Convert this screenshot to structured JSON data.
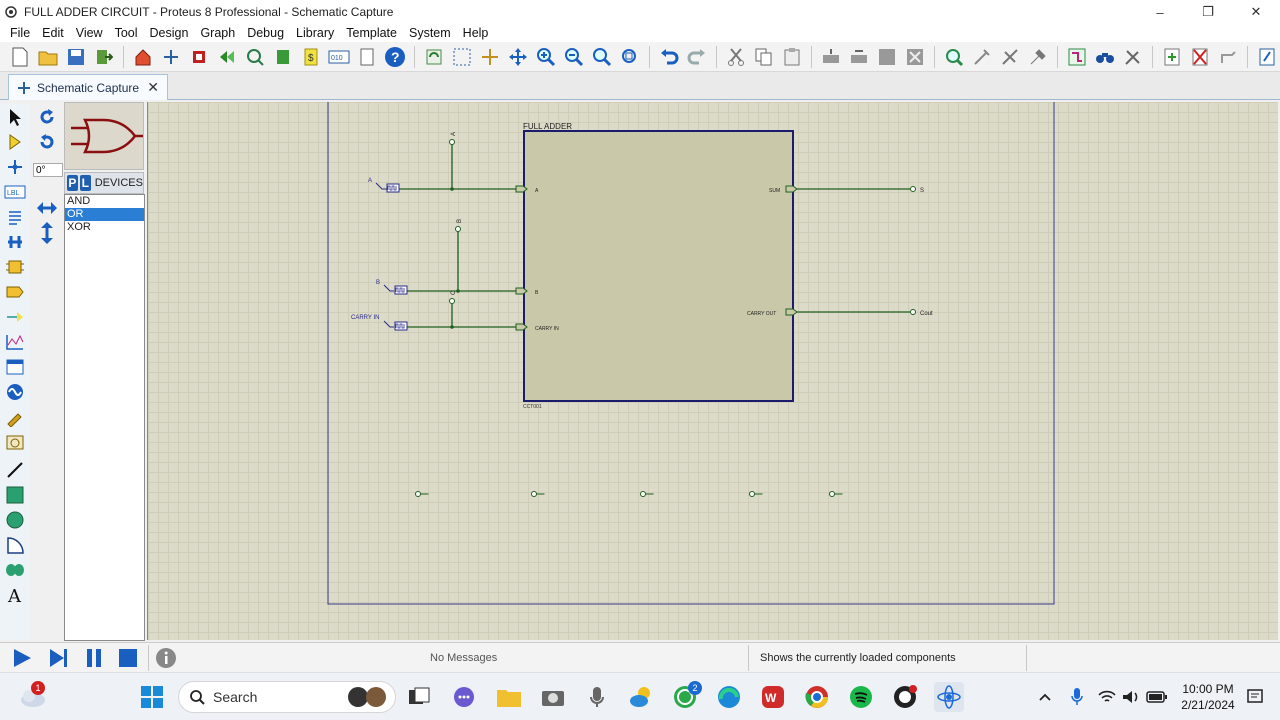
{
  "window": {
    "title": "FULL ADDER CIRCUIT - Proteus 8 Professional - Schematic Capture",
    "minimize": "–",
    "maximize": "❐",
    "close": "✕"
  },
  "menu": [
    "File",
    "Edit",
    "View",
    "Tool",
    "Design",
    "Graph",
    "Debug",
    "Library",
    "Template",
    "System",
    "Help"
  ],
  "tab": {
    "label": "Schematic Capture",
    "close": "✕"
  },
  "selector": {
    "angle": "0°",
    "p_button": "P",
    "l_button": "L",
    "header": "DEVICES",
    "devices": [
      "AND",
      "OR",
      "XOR"
    ],
    "selected": "OR"
  },
  "schematic": {
    "block_title": "FULL ADDER",
    "block_ref": "CCT001",
    "inputs": [
      "A",
      "B",
      "CARRY IN"
    ],
    "outputs": [
      "SUM",
      "CARRY OUT"
    ],
    "generator_labels": [
      "A",
      "B",
      "CARRY IN"
    ],
    "probe_labels": [
      "A",
      "B",
      "C"
    ],
    "output_terminals": [
      "S",
      "Cout"
    ]
  },
  "status": {
    "messages": "No Messages",
    "hint": "Shows the currently loaded components"
  },
  "taskbar": {
    "search": "Search",
    "time": "10:00 PM",
    "date": "2/21/2024",
    "weather_badge": "1",
    "whatsapp_badge": "2"
  },
  "colors": {
    "canvas": "#dcdac8",
    "block_fill": "#c9c8a8",
    "block_border": "#1c1c6e",
    "wire": "#1f5f1f",
    "accent": "#2a7fd4"
  }
}
